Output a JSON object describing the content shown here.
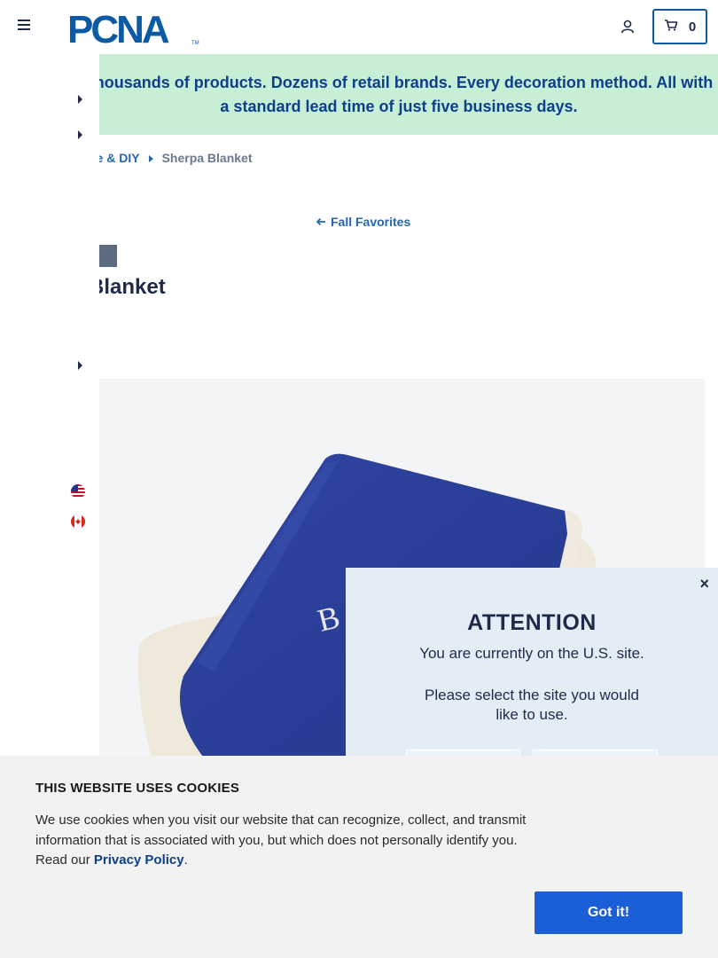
{
  "header": {
    "logo_text": "PCNA",
    "logo_tm": "TM",
    "cart_count": "0"
  },
  "promo": {
    "text": "Thousands of products. Dozens of retail brands. Every decoration method. All with a standard lead time of just five business days."
  },
  "breadcrumb": {
    "parent": "ne & DIY",
    "current": "Sherpa Blanket"
  },
  "back_link": {
    "label": "Fall Favorites"
  },
  "product": {
    "category_tag": "ry",
    "title": "Blanket"
  },
  "attention": {
    "close": "×",
    "title": "ATTENTION",
    "line1": "You are currently on the U.S. site.",
    "line2": "Please select the site you would like to use."
  },
  "cookie": {
    "title": "THIS WEBSITE USES COOKIES",
    "text_before": "We use cookies when you visit our website that can recognize, collect, and transmit information that is associated with you, but which does not personally identify you. Read our ",
    "link": "Privacy Policy",
    "text_after": ".",
    "button": "Got it!"
  },
  "colors": {
    "brand_blue": "#0a5aa4",
    "promo_bg": "#c7efd5",
    "cookie_button": "#1b5fd8"
  }
}
